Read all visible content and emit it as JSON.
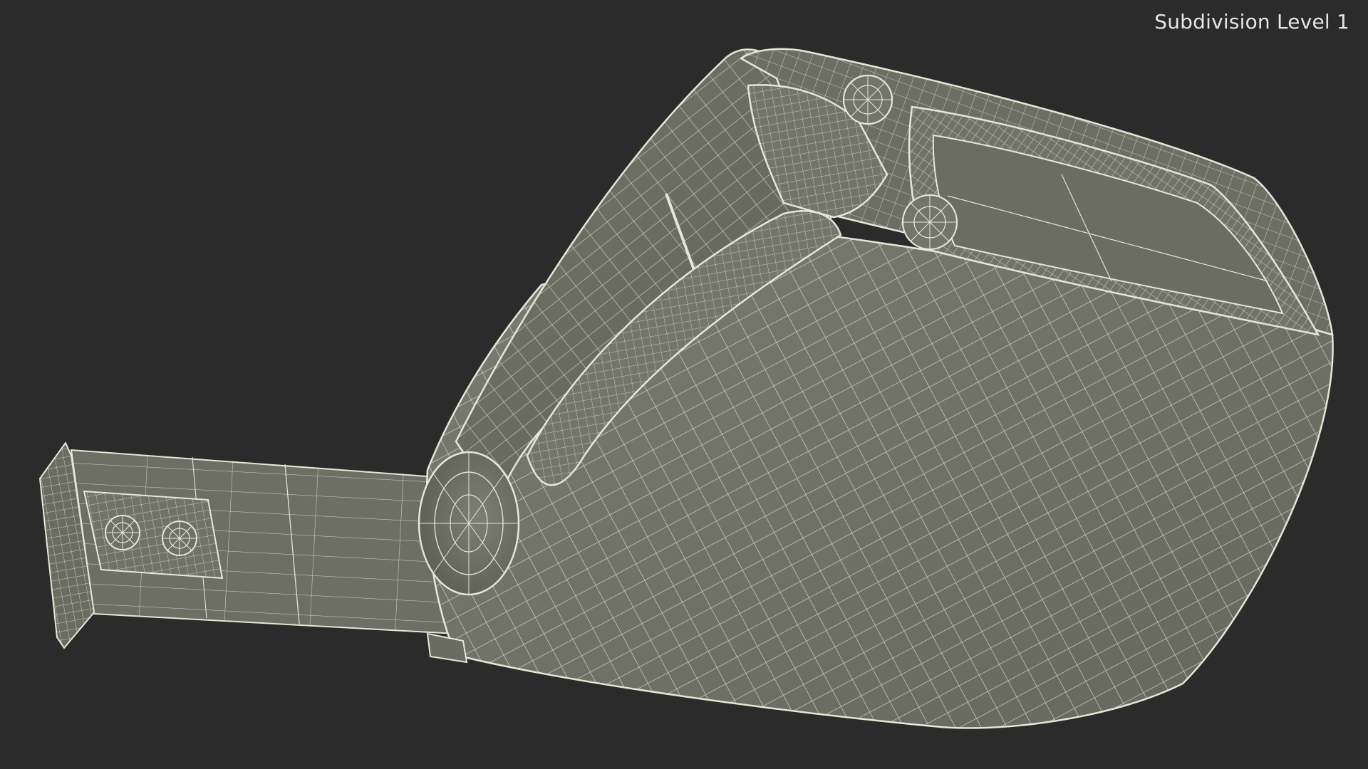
{
  "viewport": {
    "label": "Subdivision Level 1"
  },
  "colors": {
    "background": "#2b2b2b",
    "surface": "#6f7065",
    "surface_light": "#7a7b70",
    "surface_dark": "#5d5e55",
    "wire": "#e4e6d6"
  }
}
